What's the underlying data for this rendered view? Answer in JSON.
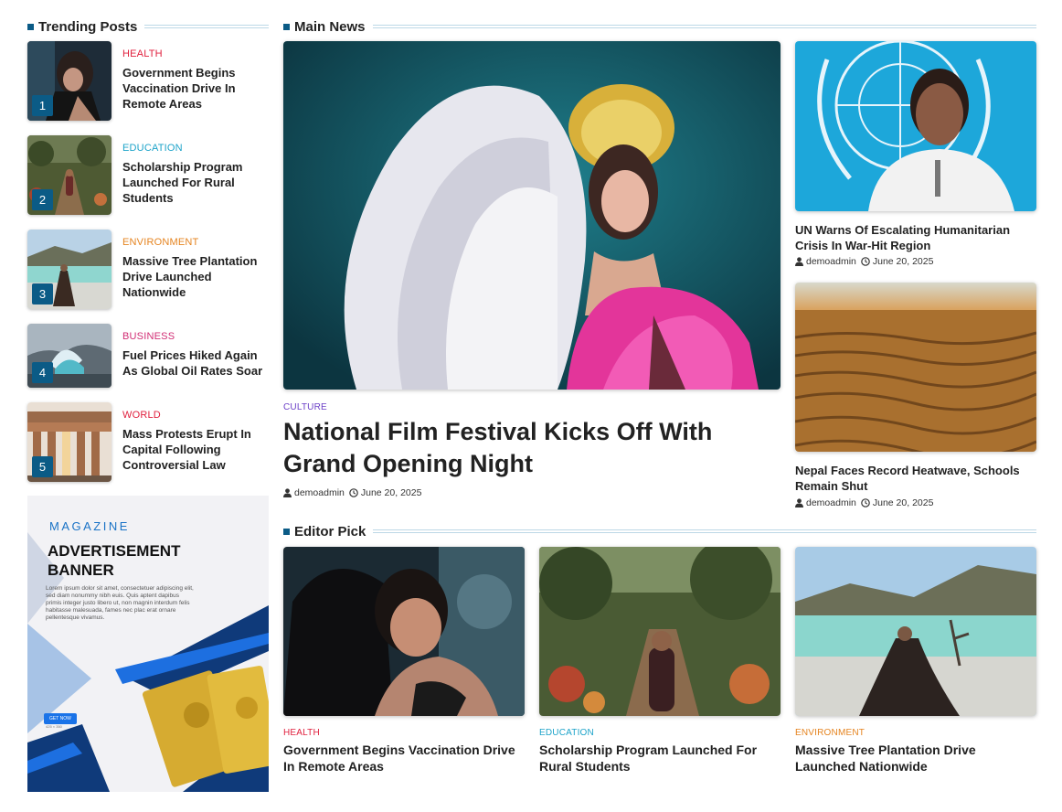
{
  "trending": {
    "title": "Trending Posts",
    "items": [
      {
        "num": "1",
        "category": "HEALTH",
        "title": "Government Begins Vaccination Drive In Remote Areas"
      },
      {
        "num": "2",
        "category": "EDUCATION",
        "title": "Scholarship Program Launched For Rural Students"
      },
      {
        "num": "3",
        "category": "ENVIRONMENT",
        "title": "Massive Tree Plantation Drive Launched Nationwide"
      },
      {
        "num": "4",
        "category": "BUSINESS",
        "title": "Fuel Prices Hiked Again As Global Oil Rates Soar"
      },
      {
        "num": "5",
        "category": "WORLD",
        "title": "Mass Protests Erupt In Capital Following Controversial Law"
      }
    ]
  },
  "ad": {
    "magazine": "MAGAZINE",
    "title": "ADVERTISEMENT BANNER",
    "body": "Lorem ipsum dolor sit amet, consectetuer adipiscing elit, sed diam nonummy nibh euis. Quis aptent dapibus primis integer justo libero ut, non magnin interdum felis habitasse malesuada, fames nec plac erat ornare pellentesque vivamus.",
    "button": "GET NOW",
    "size": "425 × 350"
  },
  "main_news": {
    "title": "Main News",
    "featured": {
      "category": "CULTURE",
      "title": "National Film Festival Kicks Off With Grand Opening Night",
      "author": "demoadmin",
      "date": "June 20, 2025"
    },
    "side": [
      {
        "title": "UN Warns Of Escalating Humanitarian Crisis In War-Hit Region",
        "author": "demoadmin",
        "date": "June 20, 2025"
      },
      {
        "title": "Nepal Faces Record Heatwave, Schools Remain Shut",
        "author": "demoadmin",
        "date": "June 20, 2025"
      }
    ]
  },
  "editor_pick": {
    "title": "Editor Pick",
    "items": [
      {
        "category": "HEALTH",
        "title": "Government Begins Vaccination Drive In Remote Areas"
      },
      {
        "category": "EDUCATION",
        "title": "Scholarship Program Launched For Rural Students"
      },
      {
        "category": "ENVIRONMENT",
        "title": "Massive Tree Plantation Drive Launched Nationwide"
      }
    ]
  },
  "colors": {
    "accent": "#0b5b86",
    "health": "#e01f3d",
    "education": "#1ca3c9",
    "environment": "#e58420",
    "business": "#d12d74",
    "world": "#e01f3d",
    "culture": "#6b3fc7"
  },
  "icons": {
    "author": "user-icon",
    "date": "clock-icon"
  }
}
